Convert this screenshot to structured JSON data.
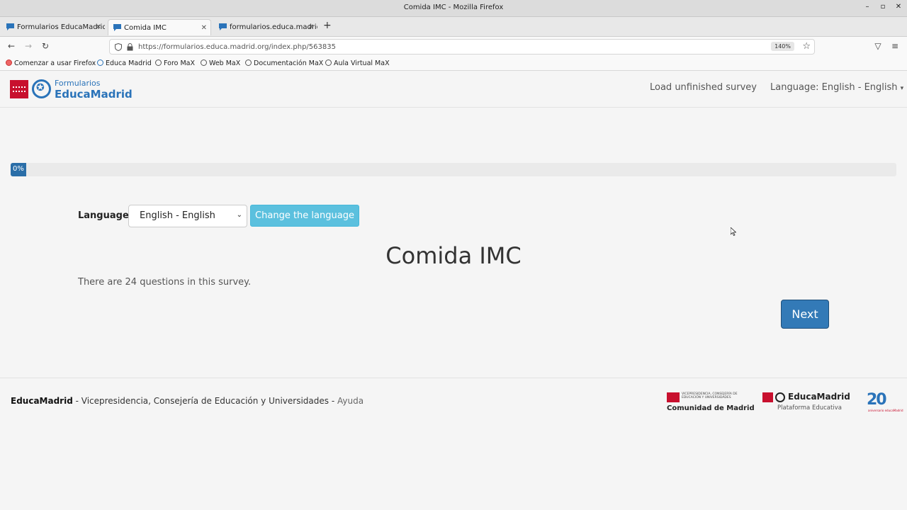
{
  "window": {
    "title": "Comida IMC - Mozilla Firefox",
    "minimize": "–",
    "maximize": "▫",
    "close": "✕"
  },
  "tabs": [
    {
      "label": "Formularios EducaMadrid",
      "close": "✕"
    },
    {
      "label": "Comida IMC",
      "close": "✕"
    },
    {
      "label": "formularios.educa.madrid",
      "close": "✕"
    }
  ],
  "new_tab": "+",
  "nav": {
    "back": "←",
    "forward": "→",
    "reload": "↻",
    "url": "https://formularios.educa.madrid.org/index.php/563835",
    "zoom": "140%",
    "bookmark_star": "☆",
    "pocket": "▽",
    "menu": "≡"
  },
  "bookmarks": [
    "Comenzar a usar Firefox",
    "Educa Madrid",
    "Foro MaX",
    "Web MaX",
    "Documentación MaX",
    "Aula Virtual MaX"
  ],
  "header": {
    "logo_small": "Formularios",
    "logo_big": "EducaMadrid",
    "load_unfinished": "Load unfinished survey",
    "language_menu": "Language: English - English"
  },
  "progress": {
    "value": 0,
    "label": "0%"
  },
  "language_row": {
    "label": "Language:",
    "selected": "English - English",
    "change_button": "Change the language"
  },
  "survey": {
    "title": "Comida IMC",
    "question_count_text": "There are 24 questions in this survey.",
    "next_button": "Next"
  },
  "footer": {
    "brand": "EducaMadrid",
    "text": " - Vicepresidencia, Consejería de Educación y Universidades - ",
    "help": "Ayuda",
    "cm_small": "VICEPRESIDENCIA, CONSEJERÍA DE EDUCACIÓN Y UNIVERSIDADES",
    "cm_big": "Comunidad de Madrid",
    "em_name": "EducaMadrid",
    "em_sub": "Plataforma Educativa",
    "anniv_num": "20",
    "anniv_sub": "aniversario educaMadrid"
  },
  "colors": {
    "primary": "#337ab7",
    "info": "#5bc0de",
    "brand_blue": "#2a73b9",
    "brand_red": "#c8102e"
  }
}
